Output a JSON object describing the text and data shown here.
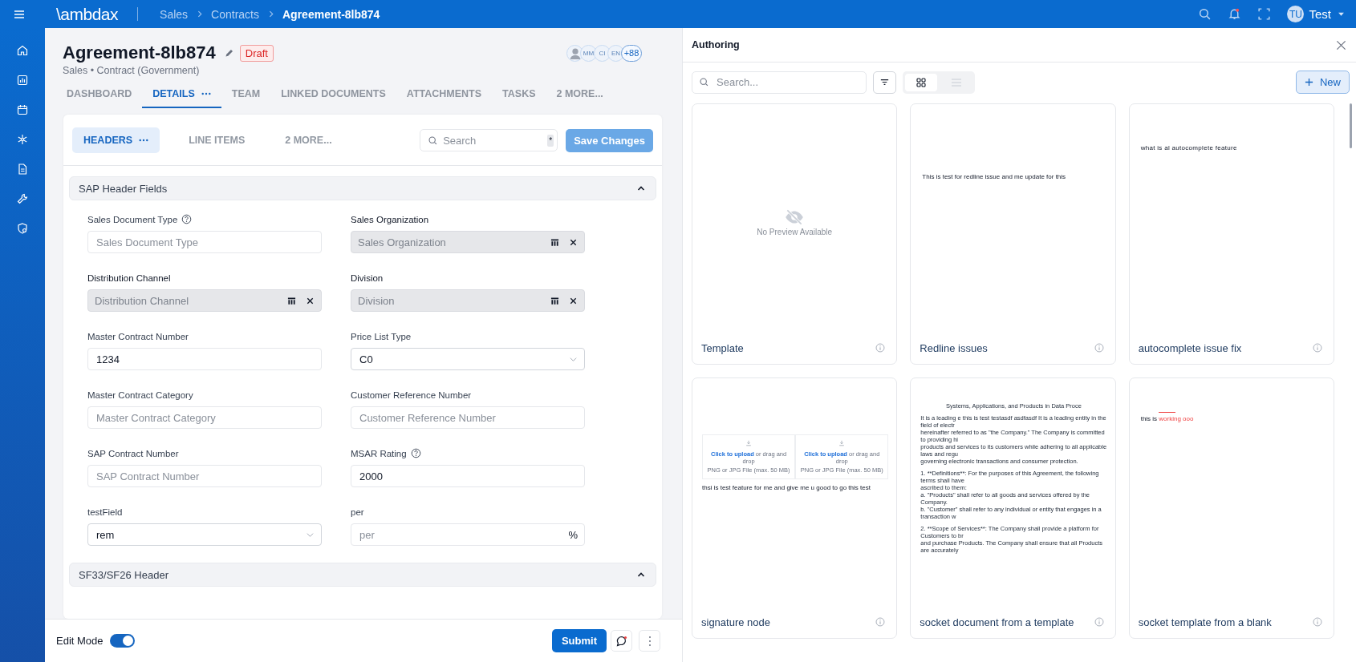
{
  "topbar": {
    "logo": "\\ambdax",
    "breadcrumb": [
      {
        "label": "Sales",
        "current": false
      },
      {
        "label": "Contracts",
        "current": false
      },
      {
        "label": "Agreement-8lb874",
        "current": true
      }
    ],
    "user": {
      "initials": "TU",
      "name": "Test"
    },
    "notification_dot": true
  },
  "record": {
    "title": "Agreement-8lb874",
    "status": "Draft",
    "subtitle": "Sales • Contract (Government)",
    "avatars": [
      {
        "kind": "photo"
      },
      {
        "kind": "initials",
        "text": "MM"
      },
      {
        "kind": "initials",
        "text": "CI"
      },
      {
        "kind": "initials",
        "text": "EN"
      },
      {
        "kind": "count",
        "text": "+88"
      }
    ]
  },
  "tabs": [
    {
      "label": "DASHBOARD",
      "selected": false,
      "menu": false
    },
    {
      "label": "DETAILS",
      "selected": true,
      "menu": true
    },
    {
      "label": "TEAM",
      "selected": false,
      "menu": false
    },
    {
      "label": "LINKED DOCUMENTS",
      "selected": false,
      "menu": false
    },
    {
      "label": "ATTACHMENTS",
      "selected": false,
      "menu": false
    },
    {
      "label": "TASKS",
      "selected": false,
      "menu": false
    },
    {
      "label": "2 MORE...",
      "selected": false,
      "menu": false
    }
  ],
  "subtabs": [
    {
      "label": "HEADERS",
      "selected": true,
      "menu": true
    },
    {
      "label": "LINE ITEMS",
      "selected": false,
      "menu": false
    },
    {
      "label": "2 MORE...",
      "selected": false,
      "menu": false
    }
  ],
  "search": {
    "placeholder": "Search",
    "shortcut": "*"
  },
  "save_button": "Save Changes",
  "sections": [
    {
      "title": "SAP Header Fields",
      "expanded": true,
      "fields": [
        {
          "label": "Sales Document Type",
          "help": true,
          "kind": "text",
          "placeholder": "Sales Document Type"
        },
        {
          "label": "Sales Organization",
          "help": false,
          "kind": "lookup",
          "placeholder": "Sales Organization"
        },
        {
          "label": "Distribution Channel",
          "help": false,
          "kind": "lookup",
          "placeholder": "Distribution Channel"
        },
        {
          "label": "Division",
          "help": false,
          "kind": "lookup",
          "placeholder": "Division"
        },
        {
          "label": "Master Contract Number",
          "help": false,
          "kind": "text",
          "value": "1234"
        },
        {
          "label": "Price List Type",
          "help": false,
          "kind": "select",
          "value": "C0"
        },
        {
          "label": "Master Contract Category",
          "help": false,
          "kind": "text",
          "placeholder": "Master Contract Category"
        },
        {
          "label": "Customer Reference Number",
          "help": false,
          "kind": "text",
          "placeholder": "Customer Reference Number"
        },
        {
          "label": "SAP Contract Number",
          "help": false,
          "kind": "text",
          "placeholder": "SAP Contract Number"
        },
        {
          "label": "MSAR Rating",
          "help": true,
          "kind": "text",
          "value": "2000"
        },
        {
          "label": "testField",
          "help": false,
          "kind": "select",
          "value": "rem"
        },
        {
          "label": "per",
          "help": false,
          "kind": "percent",
          "placeholder": "per",
          "suffix": "%"
        }
      ]
    },
    {
      "title": "SF33/SF26 Header",
      "expanded": true
    }
  ],
  "footer": {
    "edit_mode": {
      "label": "Edit Mode",
      "on": true
    },
    "submit": "Submit",
    "comment_dot": true
  },
  "authoring": {
    "title": "Authoring",
    "search": {
      "placeholder": "Search..."
    },
    "views": [
      {
        "selected": true
      },
      {
        "selected": false
      }
    ],
    "new_button": "New",
    "templates": [
      {
        "name": "Template",
        "preview": {
          "kind": "empty",
          "text": "No Preview Available"
        }
      },
      {
        "name": "Redline issues",
        "preview": {
          "kind": "text",
          "lines": [
            "This is test for redline issue and me update for this"
          ]
        }
      },
      {
        "name": "autocomplete issue fix",
        "preview": {
          "kind": "text",
          "lines": [
            "what is al autocomplete feature"
          ]
        }
      },
      {
        "name": "signature node",
        "preview": {
          "kind": "upload",
          "boxes": [
            {
              "link": "Click to upload",
              "text": "or drag and drop",
              "hint": "PNG or JPG File (max. 50 MB)"
            },
            {
              "link": "Click to upload",
              "text": "or drag and drop",
              "hint": "PNG or JPG File (max. 50 MB)"
            }
          ],
          "caption": "thsi is test feature for me and give me u good to go this test"
        }
      },
      {
        "name": "socket document from a template",
        "preview": {
          "kind": "document",
          "heading": "Systems, Applications, and Products in Data Proce",
          "paragraphs": [
            [
              "It is a leading e this is test testasdf asdfasdf It is a leading entity in the field of electr",
              "hereinafter referred to as \"the Company.\" The Company is committed to providing hi",
              "products and services to its customers while adhering to all applicable laws and regu",
              "governing electronic transactions and consumer protection."
            ],
            [
              "1. **Definitions**: For the purposes of this Agreement, the following terms shall have",
              "ascribed to them:",
              "a. \"Products\" shall refer to all goods and services offered by the Company.",
              "b. \"Customer\" shall refer to any individual or entity that engages in a transaction w"
            ],
            [
              "2. **Scope of Services**: The Company shall provide a platform for Customers to br",
              "and purchase Products. The Company shall ensure that all Products are accurately"
            ]
          ]
        }
      },
      {
        "name": "socket template from a blank",
        "preview": {
          "kind": "redline",
          "segments": [
            {
              "text": "this is ",
              "kind": "plain"
            },
            {
              "text": "working ooo",
              "kind": "inserted"
            }
          ]
        }
      }
    ]
  }
}
